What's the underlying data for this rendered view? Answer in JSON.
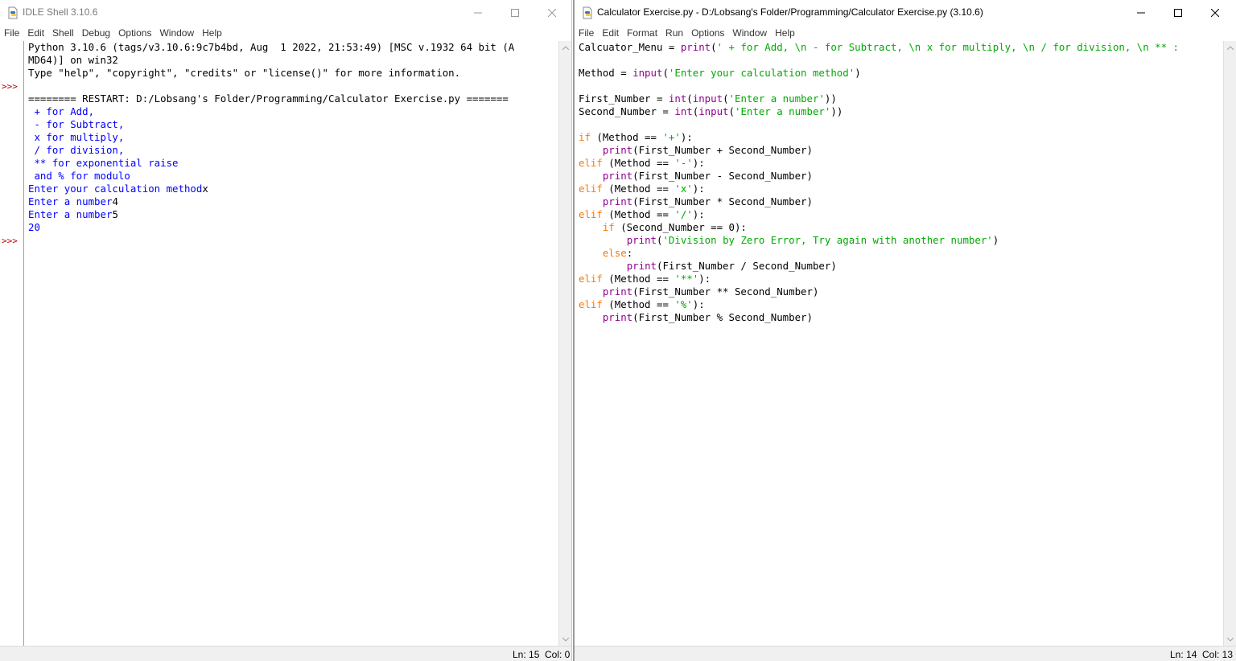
{
  "shell": {
    "title": "IDLE Shell 3.10.6",
    "menu": [
      "File",
      "Edit",
      "Shell",
      "Debug",
      "Options",
      "Window",
      "Help"
    ],
    "prompt": ">>>",
    "lines": [
      {
        "text": "Python 3.10.6 (tags/v3.10.6:9c7b4bd, Aug  1 2022, 21:53:49) [MSC v.1932 64 bit (A",
        "color": "#000000"
      },
      {
        "text": "MD64)] on win32",
        "color": "#000000"
      },
      {
        "text": "Type \"help\", \"copyright\", \"credits\" or \"license()\" for more information.",
        "color": "#000000"
      },
      {
        "text": "",
        "color": "#000000"
      },
      {
        "text": "======== RESTART: D:/Lobsang's Folder/Programming/Calculator Exercise.py =======",
        "color": "#000000"
      },
      {
        "text": " + for Add,",
        "color": "#0000ff"
      },
      {
        "text": " - for Subtract,",
        "color": "#0000ff"
      },
      {
        "text": " x for multiply,",
        "color": "#0000ff"
      },
      {
        "text": " / for division,",
        "color": "#0000ff"
      },
      {
        "text": " ** for exponential raise",
        "color": "#0000ff"
      },
      {
        "text": " and % for modulo",
        "color": "#0000ff"
      },
      {
        "text": "Enter your calculation method",
        "color": "#0000ff",
        "input": "x"
      },
      {
        "text": "Enter a number",
        "color": "#0000ff",
        "input": "4"
      },
      {
        "text": "Enter a number",
        "color": "#0000ff",
        "input": "5"
      },
      {
        "text": "20",
        "color": "#0000ff"
      }
    ],
    "status_ln": "Ln: 15",
    "status_col": "Col: 0"
  },
  "editor": {
    "title": "Calculator Exercise.py - D:/Lobsang's Folder/Programming/Calculator Exercise.py (3.10.6)",
    "menu": [
      "File",
      "Edit",
      "Format",
      "Run",
      "Options",
      "Window",
      "Help"
    ],
    "lines": [
      {
        "text": "Calcuator_Menu = print(' + for Add, \\n - for Subtract, \\n x for multiply, \\n / for division, \\n ** :"
      },
      {
        "text": ""
      },
      {
        "text": "Method = input('Enter your calculation method')"
      },
      {
        "text": ""
      },
      {
        "text": "First_Number = int(input('Enter a number'))"
      },
      {
        "text": "Second_Number = int(input('Enter a number'))"
      },
      {
        "text": ""
      },
      {
        "text": "if (Method == '+'):"
      },
      {
        "text": "    print(First_Number + Second_Number)"
      },
      {
        "text": "elif (Method == '-'):"
      },
      {
        "text": "    print(First_Number - Second_Number)"
      },
      {
        "text": "elif (Method == 'x'):"
      },
      {
        "text": "    print(First_Number * Second_Number)"
      },
      {
        "text": "elif (Method == '/'):"
      },
      {
        "text": "    if (Second_Number == 0):"
      },
      {
        "text": "        print('Division by Zero Error, Try again with another number')"
      },
      {
        "text": "    else:"
      },
      {
        "text": "        print(First_Number / Second_Number)"
      },
      {
        "text": "elif (Method == '**'):"
      },
      {
        "text": "    print(First_Number ** Second_Number)"
      },
      {
        "text": "elif (Method == '%'):"
      },
      {
        "text": "    print(First_Number % Second_Number)"
      }
    ],
    "status_ln": "Ln: 14",
    "status_col": "Col: 13"
  },
  "colors": {
    "prompt": "#c00000",
    "output": "#0000ff",
    "keyword": "#ff7700",
    "builtin": "#900090",
    "string": "#00aa00"
  },
  "icons": [
    "python-file-icon",
    "minimize-icon",
    "maximize-icon",
    "close-icon",
    "scroll-up-icon",
    "scroll-down-icon"
  ]
}
